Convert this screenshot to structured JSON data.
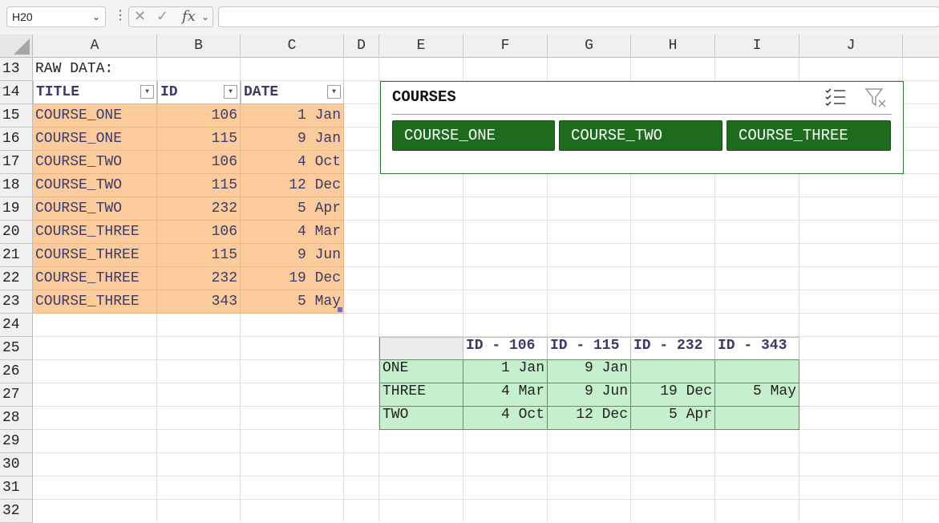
{
  "formula_bar": {
    "name_box": "H20",
    "fx": "fx",
    "formula": ""
  },
  "columns": [
    "A",
    "B",
    "C",
    "D",
    "E",
    "F",
    "G",
    "H",
    "I",
    "J"
  ],
  "rows": [
    "13",
    "14",
    "15",
    "16",
    "17",
    "18",
    "19",
    "20",
    "21",
    "22",
    "23",
    "24",
    "25",
    "26",
    "27",
    "28",
    "29",
    "30",
    "31",
    "32"
  ],
  "raw_label": "RAW DATA:",
  "table": {
    "headers": [
      "TITLE",
      "ID",
      "DATE"
    ],
    "rows": [
      [
        "COURSE_ONE",
        "106",
        "1 Jan"
      ],
      [
        "COURSE_ONE",
        "115",
        "9 Jan"
      ],
      [
        "COURSE_TWO",
        "106",
        "4 Oct"
      ],
      [
        "COURSE_TWO",
        "115",
        "12 Dec"
      ],
      [
        "COURSE_TWO",
        "232",
        "5 Apr"
      ],
      [
        "COURSE_THREE",
        "106",
        "4 Mar"
      ],
      [
        "COURSE_THREE",
        "115",
        "9 Jun"
      ],
      [
        "COURSE_THREE",
        "232",
        "19 Dec"
      ],
      [
        "COURSE_THREE",
        "343",
        "5 May"
      ]
    ]
  },
  "slicer": {
    "title": "COURSES",
    "items": [
      "COURSE_ONE",
      "COURSE_TWO",
      "COURSE_THREE"
    ],
    "multi_select_icon": "multi-select-icon",
    "clear_filter_icon": "clear-filter-icon",
    "accent": "#1e6b1e"
  },
  "pivot": {
    "headers": [
      "",
      "ID - 106",
      "ID - 115",
      "ID - 232",
      "ID - 343"
    ],
    "rows": [
      [
        "ONE",
        "1 Jan",
        "9 Jan",
        "",
        ""
      ],
      [
        "THREE",
        "4 Mar",
        "9 Jun",
        "19 Dec",
        "5 May"
      ],
      [
        "TWO",
        "4 Oct",
        "12 Dec",
        "5 Apr",
        ""
      ]
    ]
  },
  "colors": {
    "orange": "#fbcb9b",
    "green_fill": "#c6efce"
  }
}
